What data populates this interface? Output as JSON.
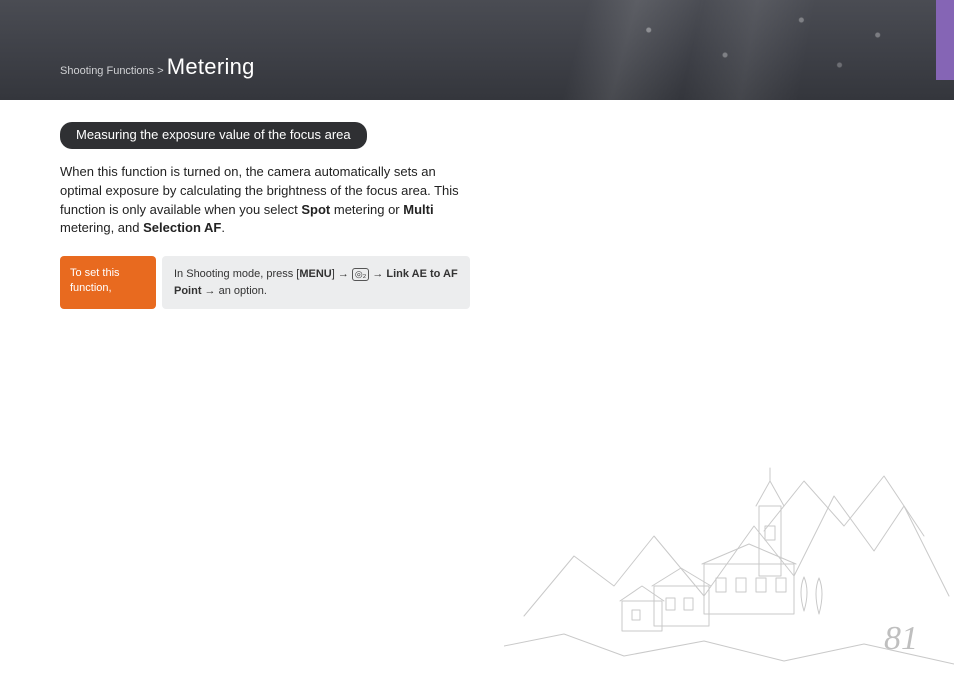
{
  "header": {
    "breadcrumb_prefix": "Shooting Functions > ",
    "title": "Metering"
  },
  "section": {
    "pill": "Measuring the exposure value of the focus area",
    "para_pre": "When this function is turned on, the camera automatically sets an optimal exposure by calculating the brightness of the focus area. This function is only available when you select ",
    "spot": "Spot",
    "para_mid": " metering or ",
    "multi": "Multi",
    "para_mid2": " metering, and ",
    "selaf": "Selection AF",
    "para_end": "."
  },
  "setbox": {
    "left": "To set this function,",
    "r_pre": "In Shooting mode, press [",
    "r_menu": "MENU",
    "r_mid": "] → ",
    "r_icon": "◎₂",
    "r_mid2": " → ",
    "r_bold": "Link AE to AF Point",
    "r_end": " → an option."
  },
  "page_number": "81"
}
